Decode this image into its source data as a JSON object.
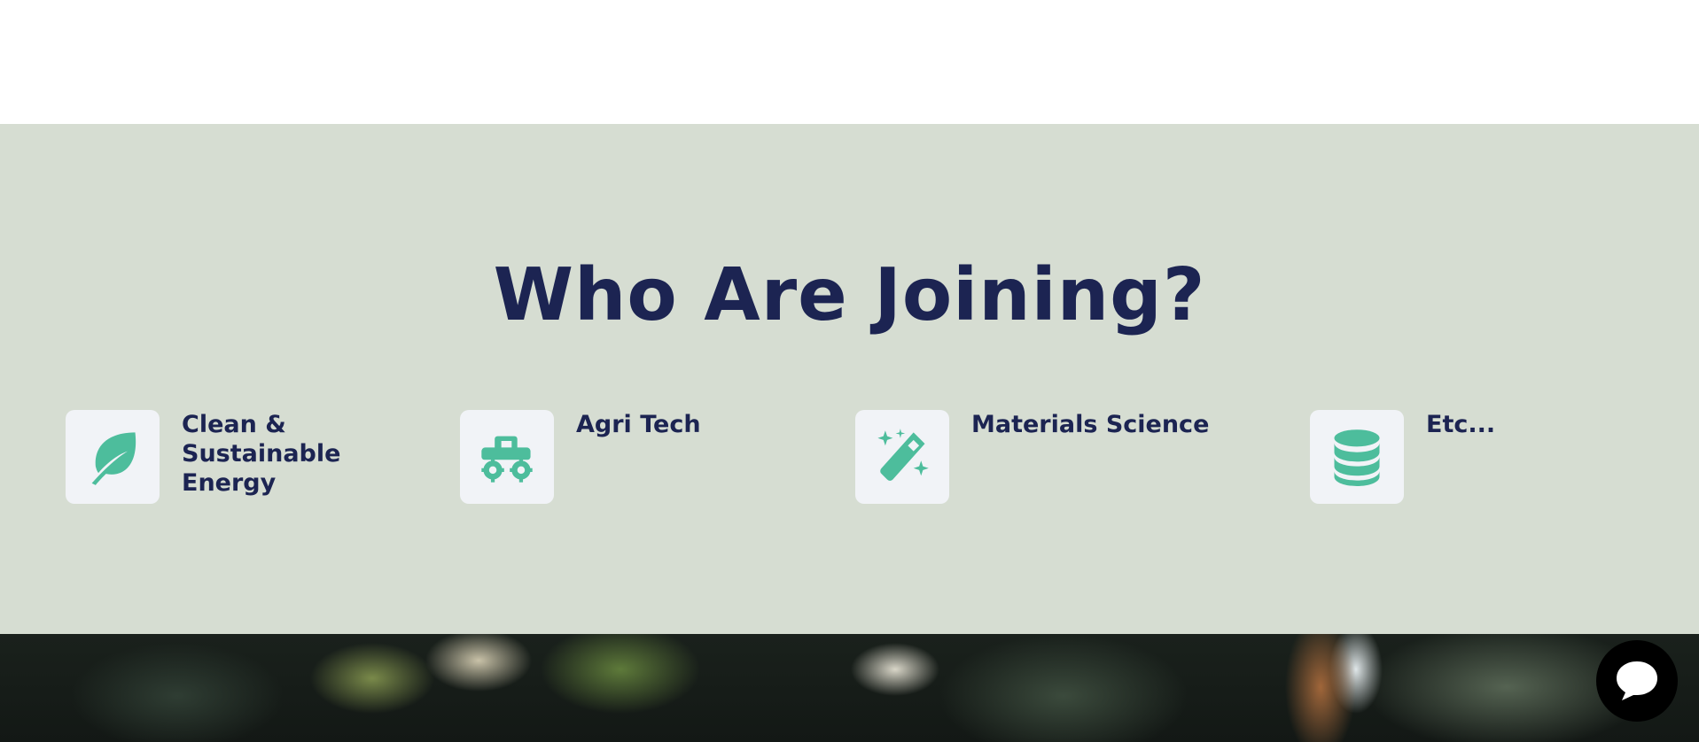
{
  "section": {
    "title": "Who Are Joining?"
  },
  "categories": [
    {
      "label": "Clean & Sustainable Energy",
      "icon": "leaf-icon"
    },
    {
      "label": "Agri Tech",
      "icon": "tractor-icon"
    },
    {
      "label": "Materials Science",
      "icon": "magic-wand-icon"
    },
    {
      "label": "Etc...",
      "icon": "database-icon"
    }
  ],
  "chat": {
    "icon": "chat-bubble-icon"
  },
  "colors": {
    "section_background": "#d6ddd2",
    "title": "#1c2452",
    "icon_accent": "#4dbd9c",
    "icon_tile": "#f1f3f7",
    "chat_button": "#000000"
  }
}
